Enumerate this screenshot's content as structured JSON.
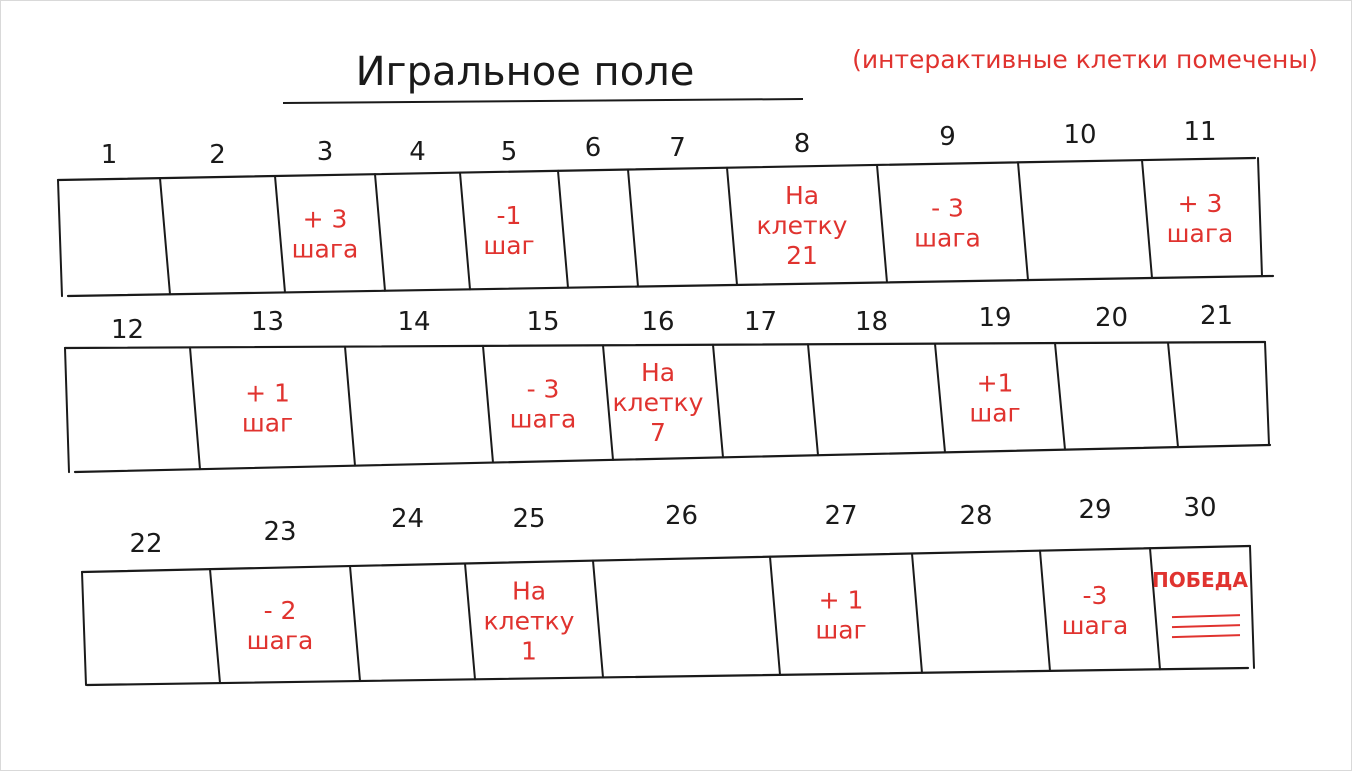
{
  "title": "Игральное поле",
  "note": "(интерактивные клетки помечены)",
  "colors": {
    "ink": "#1a1a1a",
    "red": "#e0332f",
    "frame": "#d9d9d9"
  },
  "rows": [
    {
      "numbers": [
        "1",
        "2",
        "3",
        "4",
        "5",
        "6",
        "7",
        "8",
        "9",
        "10",
        "11"
      ],
      "cells": [
        [],
        [],
        [
          "+ 3",
          "шага"
        ],
        [],
        [
          "-1",
          "шаг"
        ],
        [],
        [],
        [
          "На",
          "клетку",
          "21"
        ],
        [
          "- 3",
          "шага"
        ],
        [],
        [
          "+ 3",
          "шага"
        ]
      ]
    },
    {
      "numbers": [
        "12",
        "13",
        "14",
        "15",
        "16",
        "17",
        "18",
        "19",
        "20",
        "21"
      ],
      "cells": [
        [],
        [
          "+ 1",
          "шаг"
        ],
        [],
        [
          "- 3",
          "шага"
        ],
        [
          "На",
          "клетку",
          "7"
        ],
        [],
        [],
        [
          "+1",
          "шаг"
        ],
        [],
        []
      ]
    },
    {
      "numbers": [
        "22",
        "23",
        "24",
        "25",
        "26",
        "27",
        "28",
        "29",
        "30"
      ],
      "cells": [
        [],
        [
          "- 2",
          "шага"
        ],
        [],
        [
          "На",
          "клетку",
          "1"
        ],
        [],
        [
          "+ 1",
          "шаг"
        ],
        [],
        [
          "-3",
          "шага"
        ],
        [
          "ПОБЕДА"
        ]
      ]
    }
  ]
}
